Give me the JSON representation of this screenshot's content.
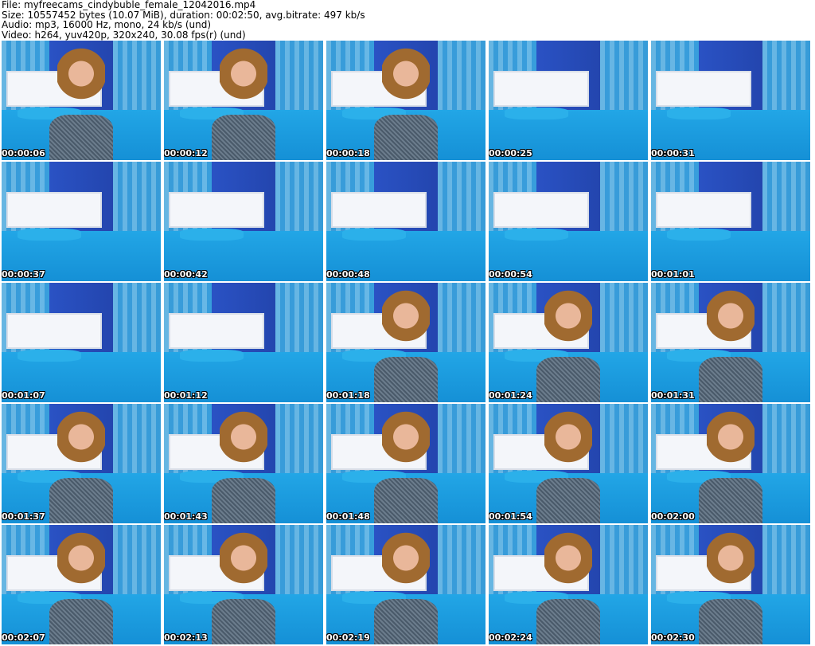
{
  "header": {
    "file": "File: myfreecams_cindybuble_female_12042016.mp4",
    "size": "Size: 10557452 bytes (10.07 MiB), duration: 00:02:50, avg.bitrate: 497 kb/s",
    "audio": "Audio: mp3, 16000 Hz, mono, 24 kb/s (und)",
    "video": "Video: h264, yuv420p, 320x240, 30.08 fps(r) (und)"
  },
  "thumbnails": [
    {
      "time": "00:00:06",
      "person": true
    },
    {
      "time": "00:00:12",
      "person": true
    },
    {
      "time": "00:00:18",
      "person": true
    },
    {
      "time": "00:00:25",
      "person": false
    },
    {
      "time": "00:00:31",
      "person": false
    },
    {
      "time": "00:00:37",
      "person": false
    },
    {
      "time": "00:00:42",
      "person": false
    },
    {
      "time": "00:00:48",
      "person": false
    },
    {
      "time": "00:00:54",
      "person": false
    },
    {
      "time": "00:01:01",
      "person": false
    },
    {
      "time": "00:01:07",
      "person": false
    },
    {
      "time": "00:01:12",
      "person": false
    },
    {
      "time": "00:01:18",
      "person": true
    },
    {
      "time": "00:01:24",
      "person": true
    },
    {
      "time": "00:01:31",
      "person": true
    },
    {
      "time": "00:01:37",
      "person": true
    },
    {
      "time": "00:01:43",
      "person": true
    },
    {
      "time": "00:01:48",
      "person": true
    },
    {
      "time": "00:01:54",
      "person": true
    },
    {
      "time": "00:02:00",
      "person": true
    },
    {
      "time": "00:02:07",
      "person": true
    },
    {
      "time": "00:02:13",
      "person": true
    },
    {
      "time": "00:02:19",
      "person": true
    },
    {
      "time": "00:02:24",
      "person": true
    },
    {
      "time": "00:02:30",
      "person": true
    }
  ]
}
